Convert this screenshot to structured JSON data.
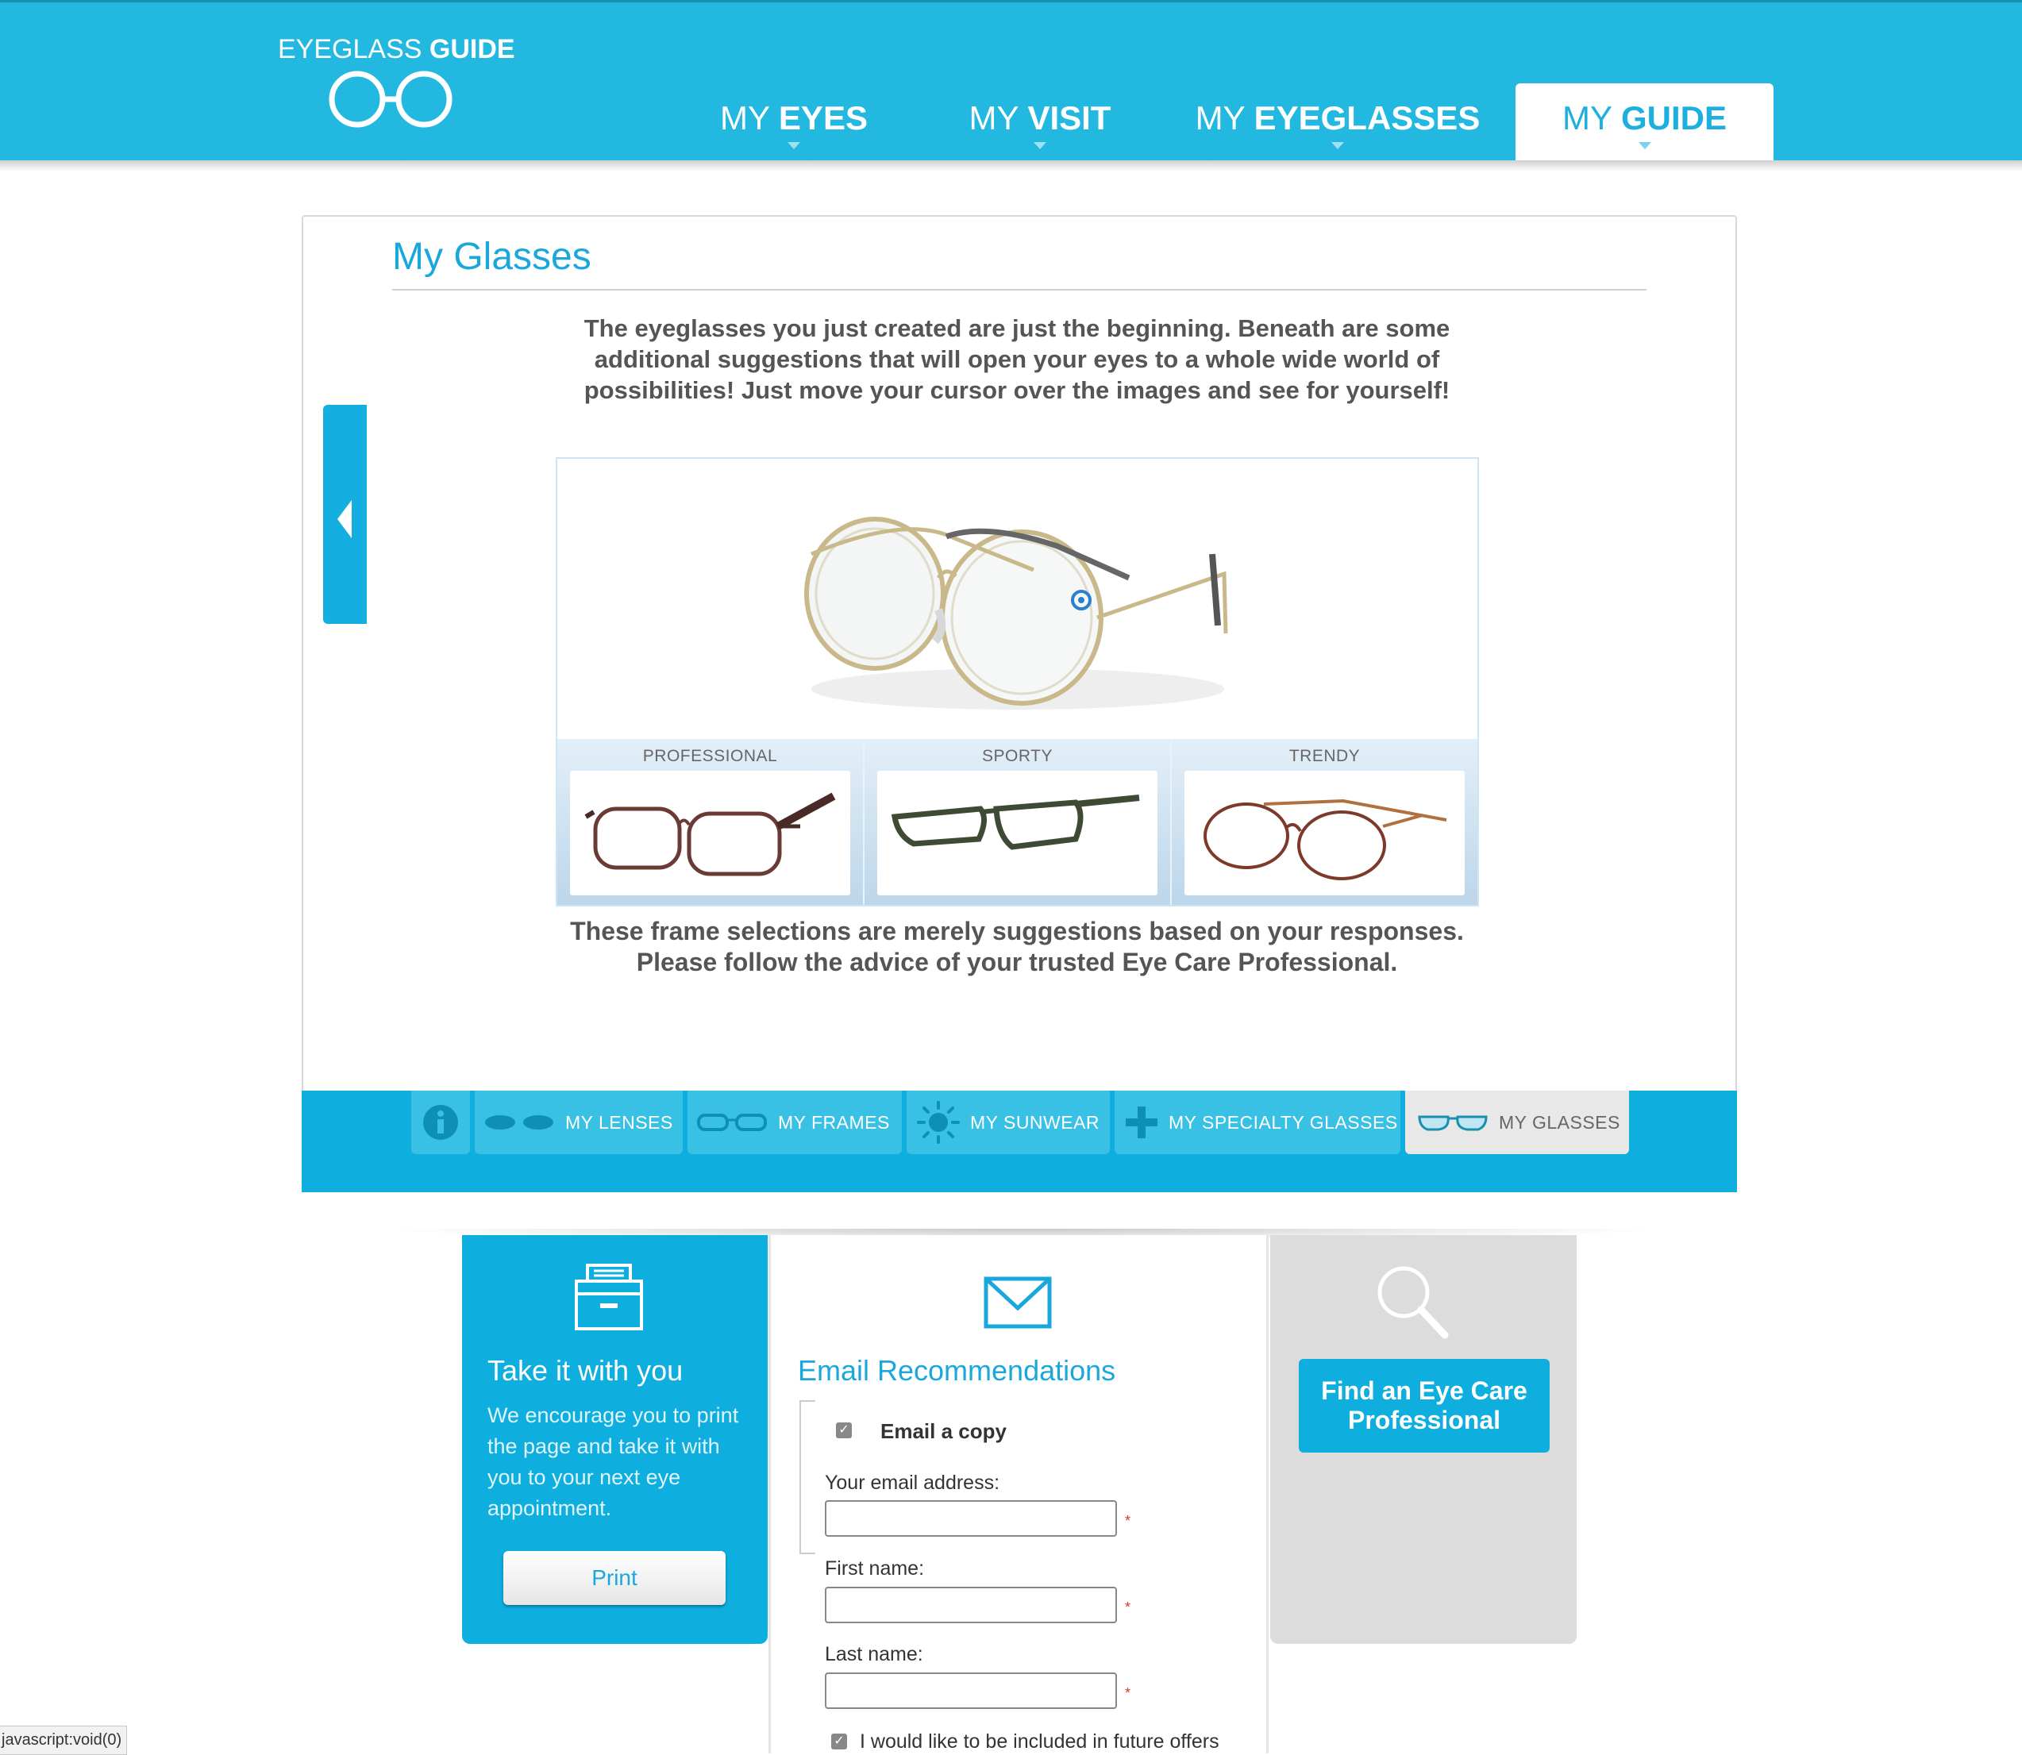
{
  "header": {
    "logo": {
      "light": "EYEGLASS",
      "bold": "GUIDE"
    },
    "tabs": [
      {
        "prefix": "MY",
        "bold": "EYES"
      },
      {
        "prefix": "MY",
        "bold": "VISIT"
      },
      {
        "prefix": "MY",
        "bold": "EYEGLASSES"
      },
      {
        "prefix": "MY",
        "bold": "GUIDE"
      }
    ],
    "active_tab": "MY GUIDE",
    "accent_color": "#22b8e0"
  },
  "panel": {
    "title": "My Glasses",
    "intro": "The eyeglasses you just created are just the beginning. Beneath are some additional suggestions that will open your eyes to a whole wide world of possibilities! Just move your cursor over the images and see for yourself!",
    "suggestions": [
      {
        "label": "PROFESSIONAL"
      },
      {
        "label": "SPORTY"
      },
      {
        "label": "TRENDY"
      }
    ],
    "disclaimer_1": "These frame selections are merely suggestions based on your responses.",
    "disclaimer_2": "Please follow the advice of your trusted Eye Care Professional."
  },
  "subnav": {
    "items": [
      {
        "label": "MY LENSES",
        "icon": "lenses-icon"
      },
      {
        "label": "MY FRAMES",
        "icon": "frames-icon"
      },
      {
        "label": "MY SUNWEAR",
        "icon": "sun-icon"
      },
      {
        "label": "MY SPECIALTY GLASSES",
        "icon": "plus-icon"
      },
      {
        "label": "MY GLASSES",
        "icon": "glasses-icon"
      }
    ],
    "active": "MY GLASSES"
  },
  "print_card": {
    "title": "Take it with you",
    "text": "We encourage you to print the page and take it with you to your next eye appointment.",
    "button": "Print"
  },
  "email_card": {
    "title": "Email Recommendations",
    "email_copy_label": "Email a copy",
    "email_copy_checked": true,
    "email_label": "Your email address:",
    "email_value": "",
    "first_label": "First name:",
    "first_value": "",
    "last_label": "Last name:",
    "last_value": "",
    "required_mark": "*",
    "offers_label": "I would like to be included in future offers",
    "offers_checked": true
  },
  "find_card": {
    "button": "Find an Eye Care Professional"
  },
  "status_bar": "javascript:void(0)"
}
